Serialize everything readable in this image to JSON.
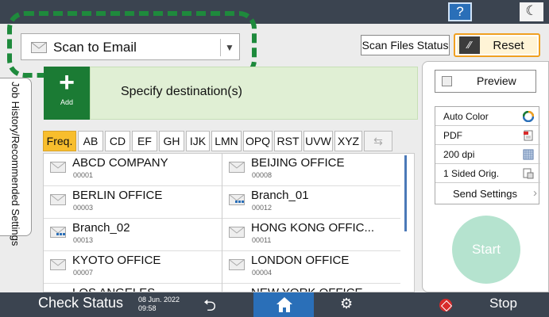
{
  "top_bar": {
    "help_label": "?",
    "moon_icon": "moon-icon"
  },
  "mode_select": {
    "value": "Scan to Email",
    "icon": "mail-icon"
  },
  "header_buttons": {
    "scan_files_status": "Scan Files Status",
    "reset": "Reset"
  },
  "side_tab": {
    "label": "Job History/Recommended Settings"
  },
  "destination": {
    "add_plus": "+",
    "add_label": "Add",
    "prompt": "Specify destination(s)"
  },
  "tabs": [
    "Freq.",
    "AB",
    "CD",
    "EF",
    "GH",
    "IJK",
    "LMN",
    "OPQ",
    "RST",
    "UVW",
    "XYZ"
  ],
  "address_book": {
    "left": [
      {
        "name": "ABCD COMPANY",
        "number": "00001",
        "icon": "mail-icon"
      },
      {
        "name": "BERLIN OFFICE",
        "number": "00003",
        "icon": "mail-icon"
      },
      {
        "name": "Branch_02",
        "number": "00013",
        "icon": "folder-group-icon"
      },
      {
        "name": "KYOTO OFFICE",
        "number": "00007",
        "icon": "mail-icon"
      },
      {
        "name": "LOS ANGELES",
        "number": "",
        "icon": "mail-icon"
      }
    ],
    "right": [
      {
        "name": "BEIJING OFFICE",
        "number": "00008",
        "icon": "mail-icon"
      },
      {
        "name": "Branch_01",
        "number": "00012",
        "icon": "folder-group-icon"
      },
      {
        "name": "HONG KONG OFFIC...",
        "number": "00011",
        "icon": "mail-icon"
      },
      {
        "name": "LONDON OFFICE",
        "number": "00004",
        "icon": "mail-icon"
      },
      {
        "name": "NEW YORK OFFICE",
        "number": "",
        "icon": "mail-icon"
      }
    ]
  },
  "right_panel": {
    "preview": "Preview",
    "settings": [
      {
        "label": "Auto Color",
        "icon": "auto-color-icon"
      },
      {
        "label": "PDF",
        "icon": "pdf-file-icon"
      },
      {
        "label": "200 dpi",
        "icon": "resolution-icon"
      },
      {
        "label": "1 Sided Orig.",
        "icon": "one-sided-icon"
      }
    ],
    "send_settings": "Send Settings",
    "start": "Start"
  },
  "bottom_bar": {
    "check_status": "Check Status",
    "date": "08 Jun. 2022",
    "time": "09:58",
    "stop": "Stop"
  },
  "colors": {
    "bar": "#3b4450",
    "accent_blue": "#2a6fb8",
    "active_tab": "#f8be2d",
    "add_green": "#1b7b34",
    "highlight_green": "#1e8a3c",
    "start": "#b5e3cf",
    "reset_border": "#f0a020"
  }
}
